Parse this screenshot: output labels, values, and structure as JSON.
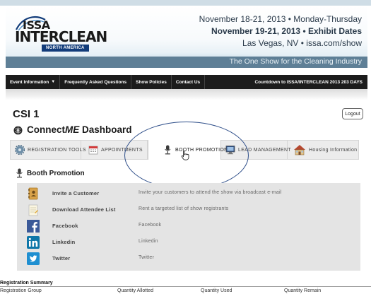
{
  "banner": {
    "logo_top": "ISSA",
    "logo_main": "INTERCLEAN",
    "logo_region": "NORTH AMERICA",
    "event_dates": "November 18-21, 2013 • Monday-Thursday",
    "exhibit_dates": "November 19-21, 2013 • Exhibit Dates",
    "location": "Las Vegas, NV • issa.com/show",
    "tagline": "The One Show for the Cleaning Industry"
  },
  "nav": {
    "items": [
      {
        "label": "Event Information",
        "has_caret": true
      },
      {
        "label": "Frequently Asked Questions"
      },
      {
        "label": "Show Policies"
      },
      {
        "label": "Contact Us"
      }
    ],
    "caret": "▼",
    "countdown": "Countdown to ISSA/INTERCLEAN 2013  203 DAYS"
  },
  "page": {
    "title": "CSI 1",
    "logout_label": "Logout",
    "dashboard_prefix": "Connect",
    "dashboard_me": "ME",
    "dashboard_suffix": " Dashboard"
  },
  "tabs": [
    {
      "label": "REGISTRATION TOOLS",
      "icon": "gear-icon"
    },
    {
      "label": "APPOINTMENTS",
      "icon": "calendar-icon"
    },
    {
      "label": "BOOTH PROMOTION",
      "icon": "microphone-icon",
      "active": true
    },
    {
      "label": "LEAD MANAGEMENT",
      "icon": "monitor-icon"
    },
    {
      "label": "Housing Information",
      "icon": "house-icon"
    }
  ],
  "section": {
    "title": "Booth Promotion"
  },
  "promotions": [
    {
      "label": "Invite a Customer",
      "description": "Invite your customers to attend the show via broadcast e-mail",
      "icon": "address-book-icon"
    },
    {
      "label": "Download Attendee List",
      "description": "Rent a targeted list of show registrants",
      "icon": "notepad-icon"
    },
    {
      "label": "Facebook",
      "description": "Facebook",
      "icon": "facebook-icon"
    },
    {
      "label": "Linkedin",
      "description": "Linkedin",
      "icon": "linkedin-icon"
    },
    {
      "label": "Twitter",
      "description": "Twitter",
      "icon": "twitter-icon"
    }
  ],
  "registration_summary": {
    "title": "Registration Summary",
    "columns": [
      "Registration Group",
      "Quantity Allotted",
      "Quantity Used",
      "Quantity Remain"
    ]
  },
  "colors": {
    "navbar": "#1c1c1c",
    "tagline_bar": "#5e7f96",
    "highlight_oval": "#2f4f8a",
    "promo_background": "#e4e4e4"
  }
}
